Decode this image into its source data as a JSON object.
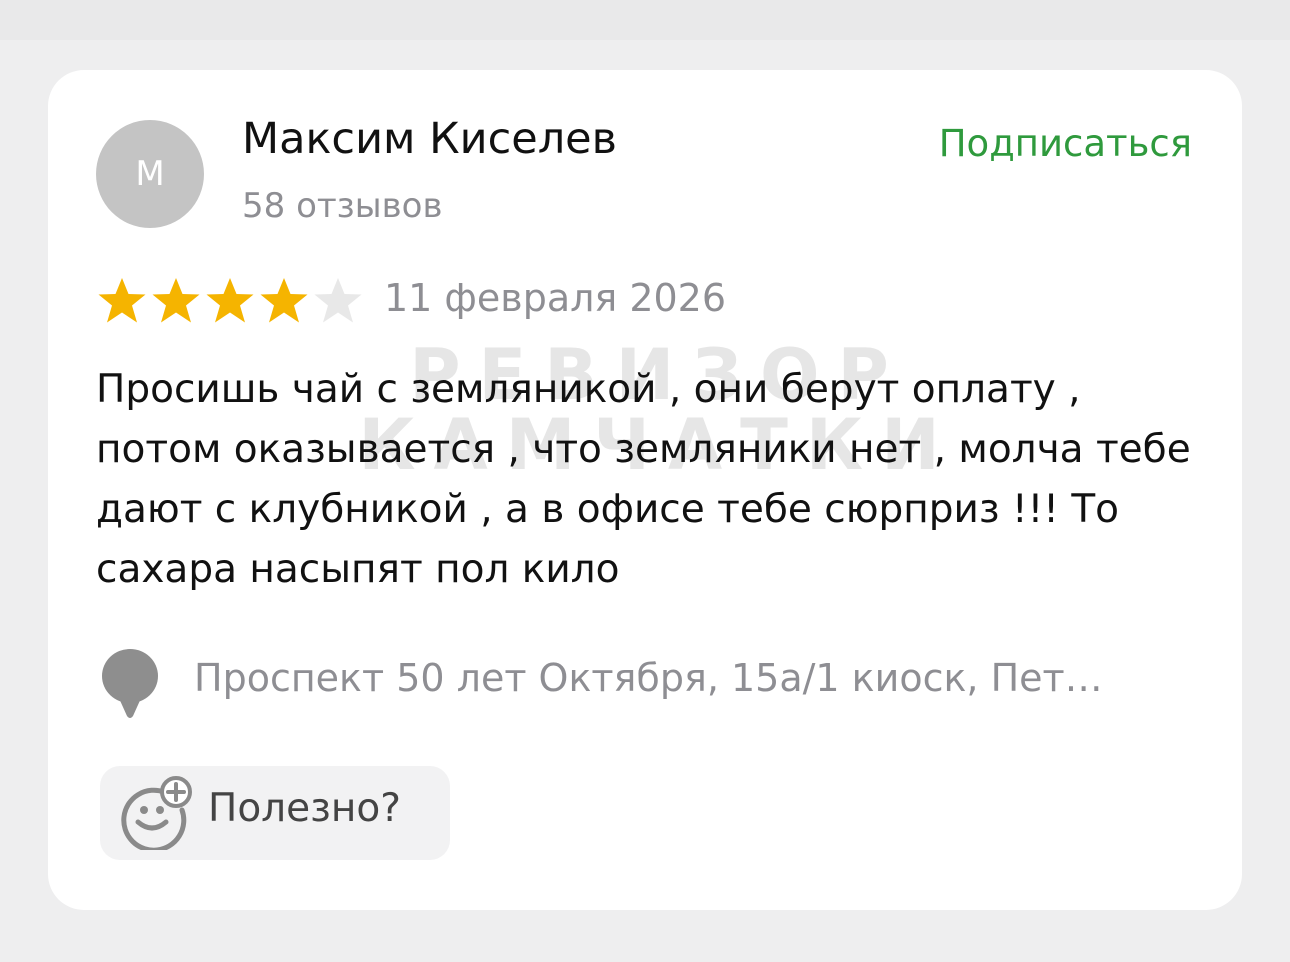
{
  "author": {
    "avatar_letter": "М",
    "name": "Максим Киселев",
    "reviews_count": "58 отзывов"
  },
  "subscribe_label": "Подписаться",
  "rating": {
    "value": 4,
    "max": 5,
    "filled_color": "#f5b400",
    "empty_color": "#e8e8e8"
  },
  "review_date": "11 февраля 2026",
  "watermark": {
    "line1": "РЕВИЗОР",
    "line2": "КАМЧАТКИ"
  },
  "review_text": "Просишь чай с земляникой , они берут оплату , потом оказывается , что земляники нет , молча тебе дают с клубникой , а в офисе тебе сюрприз !!! То сахара насыпят пол кило",
  "address": "Проспект 50 лет Октября, 15а/1 киоск, Пет…",
  "useful_label": "Полезно?",
  "colors": {
    "accent_green": "#2f9a3d",
    "secondary_text": "#8e8e93"
  },
  "icons": [
    "location-pin-icon",
    "smiley-plus-icon",
    "star-icon"
  ]
}
